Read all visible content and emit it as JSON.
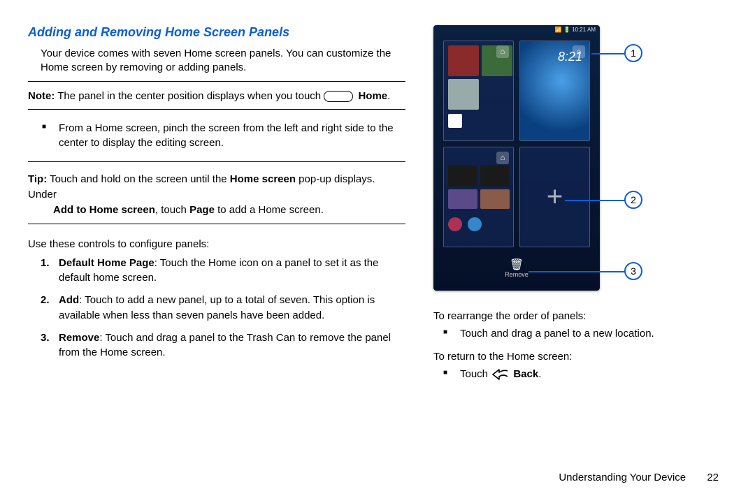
{
  "heading": "Adding and Removing Home Screen Panels",
  "intro": "Your device comes with seven Home screen panels. You can customize the Home screen by removing or adding panels.",
  "note_prefix": "Note:",
  "note_body_1": " The panel in the center position displays when you touch ",
  "note_home": "Home",
  "note_body_2": ".",
  "bullet1": "From a Home screen, pinch the screen from the left and right side to the center to display the editing screen.",
  "tip_prefix": "Tip:",
  "tip_body_1": " Touch and hold on the screen until the ",
  "tip_bold_1": "Home screen",
  "tip_body_2": " pop-up displays. Under ",
  "tip_bold_2": "Add to Home screen",
  "tip_body_3": ", touch ",
  "tip_bold_3": "Page",
  "tip_body_4": " to add a Home screen.",
  "uselabel": "Use these controls to configure panels:",
  "list": {
    "n1": "1.",
    "n1_bold": "Default Home Page",
    "n1_rest": ": Touch the Home icon on a panel to set it as the default home screen.",
    "n2": "2.",
    "n2_bold": "Add",
    "n2_rest": ": Touch to add a new panel, up to a total of seven. This option is available when less than seven panels have been added.",
    "n3": "3.",
    "n3_bold": "Remove",
    "n3_rest": ": Touch and drag a panel to the Trash Can to remove the panel from the Home screen."
  },
  "phone": {
    "time_status": "10:21 AM",
    "clock": "8:21",
    "remove_label": "Remove"
  },
  "callouts": {
    "c1": "1",
    "c2": "2",
    "c3": "3"
  },
  "rearrange_label": "To rearrange the order of panels:",
  "rearrange_bullet": "Touch and drag a panel to a new location.",
  "return_label": "To return to the Home screen:",
  "return_bullet_pre": "Touch ",
  "return_bullet_bold": "Back",
  "return_bullet_post": ".",
  "footer_section": "Understanding Your Device",
  "footer_page": "22"
}
